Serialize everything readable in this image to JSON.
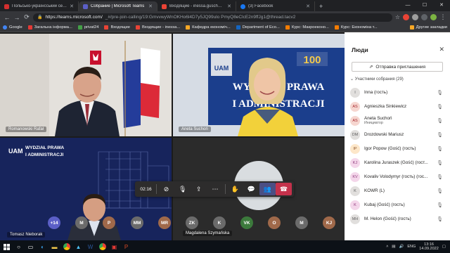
{
  "browser": {
    "tabs": [
      {
        "label": "Польсько-українсський семінар",
        "active": false,
        "color": "#d32f2f"
      },
      {
        "label": "Собрание | Microsoft Teams",
        "active": true,
        "color": "#5b5fc7"
      },
      {
        "label": "Входящие - inessa.guscha@gm",
        "active": false,
        "color": "#ea4335"
      },
      {
        "label": "(3) Facebook",
        "active": false,
        "color": "#1877f2"
      }
    ],
    "url_host": "https://teams.microsoft.com/",
    "url_path": "_#/pre-join-calling/19:GmvvwyWnOKHo6l4D7y5JQ99ulo PmyQ8eClcE2n9ffJg1@thread.tacv2",
    "bookmarks": [
      {
        "label": "Google",
        "color": "#4285f4"
      },
      {
        "label": "Загальна інформа...",
        "color": "#e53935"
      },
      {
        "label": "privat24",
        "color": "#43a047"
      },
      {
        "label": "Входящие",
        "color": "#ea4335"
      },
      {
        "label": "Входящие - inessa...",
        "color": "#ea4335"
      },
      {
        "label": "Кафедра економіч...",
        "color": "#f9a825"
      },
      {
        "label": "Department of Eco...",
        "color": "#1565c0"
      },
      {
        "label": "Курс: Макроеконо...",
        "color": "#f57c00"
      },
      {
        "label": "Курс: Економіна т...",
        "color": "#f57c00"
      },
      {
        "label": "Другие закладки",
        "color": "#f9a825"
      }
    ]
  },
  "meeting": {
    "tiles": [
      {
        "name": "Romanowski Rafał"
      },
      {
        "name": "Aneta Suchoń",
        "banner_title": "WYDZIAŁ PRAWA\nI ADMINISTRACJI",
        "badge": "100",
        "banner_logo": "UAM"
      },
      {
        "name": "Tomasz Nieborak",
        "banner_logo": "UAM",
        "banner_title": "WYDZIAŁ PRAWA\nI ADMINISTRACJI"
      },
      {
        "name": "Magdalena Szymańska"
      }
    ],
    "timer": "02:16",
    "avatars": [
      {
        "label": "+14",
        "color": "#5b5fc7"
      },
      {
        "label": "M",
        "color": "#6b6b6b"
      },
      {
        "label": "P",
        "color": "#a0694a"
      },
      {
        "label": "MM",
        "color": "#6b6b6b"
      },
      {
        "label": "MR",
        "color": "#a0694a"
      },
      {
        "label": "ZK",
        "color": "#6b6b6b"
      },
      {
        "label": "K",
        "color": "#6b6b6b"
      },
      {
        "label": "VK",
        "color": "#3c7a3c"
      },
      {
        "label": "O",
        "color": "#a0694a"
      },
      {
        "label": "M",
        "color": "#6b6b6b"
      },
      {
        "label": "KJ",
        "color": "#a0694a"
      }
    ]
  },
  "people": {
    "title": "Люди",
    "invite_label": "Отправка приглашения",
    "section_label": "Участники собрания (29)",
    "participants": [
      {
        "initials": "I",
        "name": "Inna (гость)",
        "role": "",
        "bg": "#e1dfdd",
        "fg": "#616161"
      },
      {
        "initials": "AS",
        "name": "Agnieszka Sinkiewicz",
        "role": "",
        "bg": "#f6d6d0",
        "fg": "#a4262c"
      },
      {
        "initials": "AS",
        "name": "Aneta Suchoń",
        "role": "Инициатор",
        "bg": "#f6d6d0",
        "fg": "#a4262c"
      },
      {
        "initials": "DM",
        "name": "Drozdowski Mariusz",
        "role": "",
        "bg": "#e1dfdd",
        "fg": "#616161"
      },
      {
        "initials": "IP",
        "name": "Igor Popow (Gość) (гость)",
        "role": "",
        "bg": "#fde7c9",
        "fg": "#8e562e"
      },
      {
        "initials": "KJ",
        "name": "Karolina Juraszek (Gość) (гост...",
        "role": "",
        "bg": "#f4d6ea",
        "fg": "#8f3c7e"
      },
      {
        "initials": "KV",
        "name": "Kovaliv Volodymyr (гость) (гос...",
        "role": "",
        "bg": "#f4d6ea",
        "fg": "#8f3c7e"
      },
      {
        "initials": "K",
        "name": "KOWR (L)",
        "role": "",
        "bg": "#e1dfdd",
        "fg": "#616161"
      },
      {
        "initials": "K",
        "name": "Kubaj (Gość) (гость)",
        "role": "",
        "bg": "#f4d6ea",
        "fg": "#8f3c7e"
      },
      {
        "initials": "MH",
        "name": "M. Helon (Gość) (гость)",
        "role": "",
        "bg": "#e1dfdd",
        "fg": "#616161"
      }
    ]
  },
  "taskbar": {
    "language": "ENG",
    "time": "13:16",
    "date": "14.09.2022"
  }
}
